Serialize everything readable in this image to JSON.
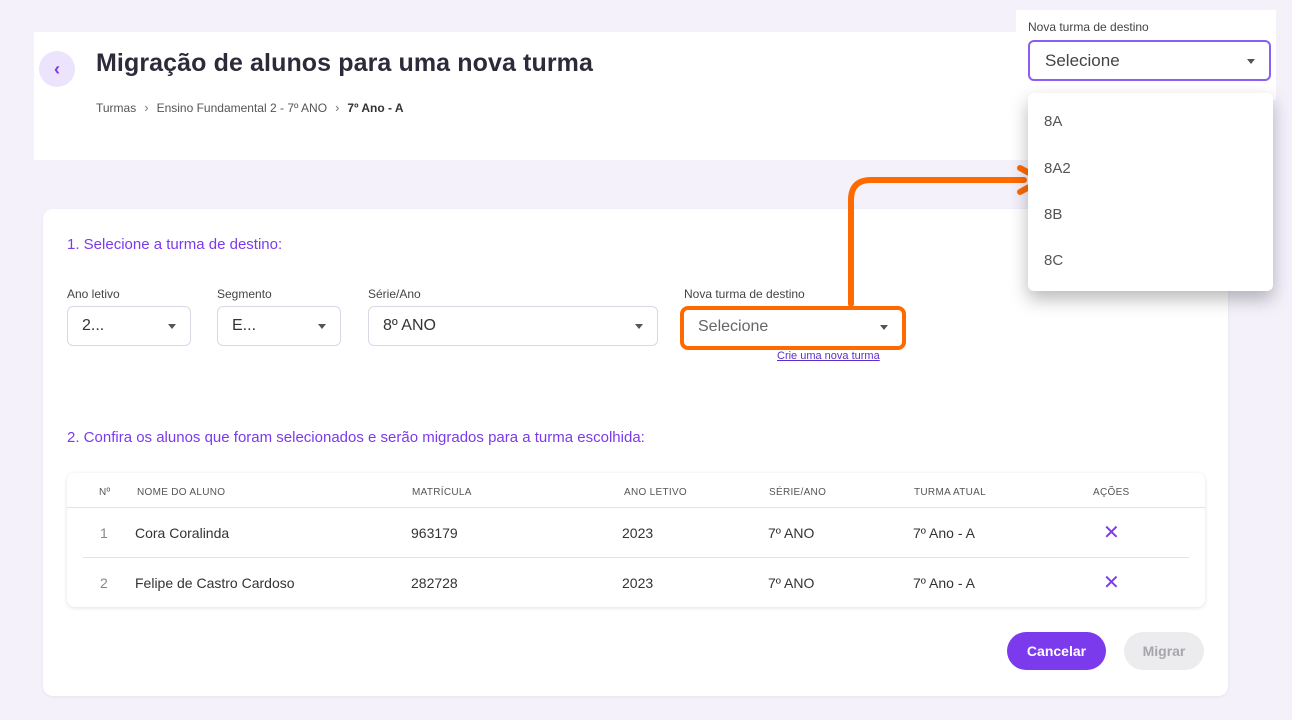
{
  "header": {
    "back_icon": "chevron-left-icon",
    "title": "Migração de alunos para uma nova turma",
    "breadcrumb": [
      "Turmas",
      "Ensino Fundamental 2 - 7º ANO",
      "7º Ano - A"
    ]
  },
  "step1": {
    "title": "1. Selecione a turma de destino:",
    "ano_letivo": {
      "label": "Ano letivo",
      "value": "2..."
    },
    "segmento": {
      "label": "Segmento",
      "value": "E..."
    },
    "serie_ano": {
      "label": "Série/Ano",
      "value": "8º ANO"
    },
    "nova_turma": {
      "label": "Nova turma de destino",
      "placeholder": "Selecione"
    },
    "create_link": "Crie uma nova turma"
  },
  "step2": {
    "title": "2. Confira os alunos que foram selecionados e serão migrados para a turma escolhida:",
    "columns": [
      "Nº",
      "NOME DO ALUNO",
      "MATRÍCULA",
      "ANO LETIVO",
      "SÉRIE/ANO",
      "TURMA ATUAL",
      "AÇÕES"
    ],
    "rows": [
      {
        "num": "1",
        "name": "Cora Coralinda",
        "matricula": "963179",
        "ano": "2023",
        "serie": "7º ANO",
        "turma": "7º Ano - A",
        "action_icon": "close-icon"
      },
      {
        "num": "2",
        "name": "Felipe de Castro Cardoso",
        "matricula": "282728",
        "ano": "2023",
        "serie": "7º ANO",
        "turma": "7º Ano - A",
        "action_icon": "close-icon"
      }
    ]
  },
  "actions": {
    "cancel": "Cancelar",
    "migrate": "Migrar"
  },
  "dropdown": {
    "label": "Nova turma de destino",
    "placeholder": "Selecione",
    "options": [
      "8A",
      "8A2",
      "8B",
      "8C"
    ]
  },
  "colors": {
    "accent": "#7c3aed",
    "highlight": "#ff6a00",
    "background": "#f4f1fb"
  }
}
